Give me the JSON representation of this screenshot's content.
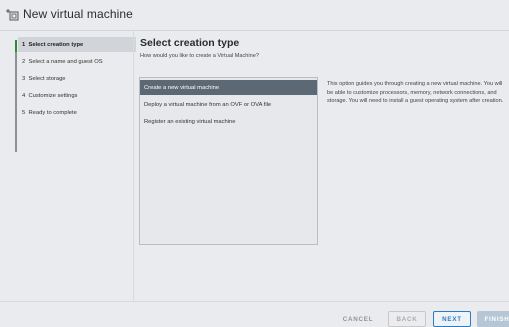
{
  "window": {
    "title": "New virtual machine",
    "icon": "new-vm-icon"
  },
  "steps": [
    {
      "num": "1",
      "label": "Select creation type",
      "active": true
    },
    {
      "num": "2",
      "label": "Select a name and guest OS",
      "active": false
    },
    {
      "num": "3",
      "label": "Select storage",
      "active": false
    },
    {
      "num": "4",
      "label": "Customize settings",
      "active": false
    },
    {
      "num": "5",
      "label": "Ready to complete",
      "active": false
    }
  ],
  "main": {
    "title": "Select creation type",
    "subtitle": "How would you like to create a Virtual Machine?",
    "options": [
      {
        "label": "Create a new virtual machine",
        "selected": true
      },
      {
        "label": "Deploy a virtual machine from an OVF or OVA file",
        "selected": false
      },
      {
        "label": "Register an existing virtual machine",
        "selected": false
      }
    ],
    "description": "This option guides you through creating a new virtual machine. You will be able to customize processors, memory, network connections, and storage. You will need to install a guest operating system after creation."
  },
  "footer": {
    "cancel": "CANCEL",
    "back": "BACK",
    "next": "NEXT",
    "finish": "FINISH"
  },
  "colors": {
    "active_step_marker": "#2e8b2e",
    "selected_option_bg": "#5c6873",
    "next_button": "#2d7cc1"
  }
}
